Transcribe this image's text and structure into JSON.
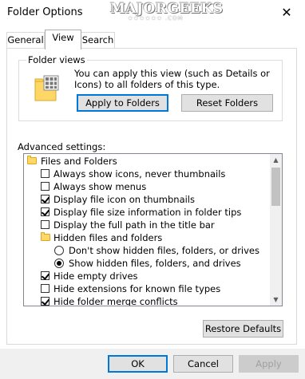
{
  "window": {
    "title": "Folder Options",
    "close_glyph": "✕"
  },
  "watermark": {
    "text": "MAJORGEEKS",
    "sub": "★★★★★★ .COM"
  },
  "tabs": [
    {
      "label": "General",
      "active": false
    },
    {
      "label": "View",
      "active": true
    },
    {
      "label": "Search",
      "active": false
    }
  ],
  "folder_views": {
    "label": "Folder views",
    "description": "You can apply this view (such as Details or Icons) to all folders of this type.",
    "apply_label": "Apply to Folders",
    "reset_label": "Reset Folders"
  },
  "advanced": {
    "label": "Advanced settings:",
    "items": [
      {
        "type": "folder",
        "label": "Files and Folders"
      },
      {
        "type": "checkbox",
        "label": "Always show icons, never thumbnails",
        "checked": false
      },
      {
        "type": "checkbox",
        "label": "Always show menus",
        "checked": false
      },
      {
        "type": "checkbox",
        "label": "Display file icon on thumbnails",
        "checked": true
      },
      {
        "type": "checkbox",
        "label": "Display file size information in folder tips",
        "checked": true
      },
      {
        "type": "checkbox",
        "label": "Display the full path in the title bar",
        "checked": false
      },
      {
        "type": "folder",
        "label": "Hidden files and folders",
        "indent": 1
      },
      {
        "type": "radio",
        "label": "Don't show hidden files, folders, or drives",
        "checked": false,
        "indent": 2
      },
      {
        "type": "radio",
        "label": "Show hidden files, folders, and drives",
        "checked": true,
        "indent": 2
      },
      {
        "type": "checkbox",
        "label": "Hide empty drives",
        "checked": true
      },
      {
        "type": "checkbox",
        "label": "Hide extensions for known file types",
        "checked": false
      },
      {
        "type": "checkbox",
        "label": "Hide folder merge conflicts",
        "checked": true
      }
    ]
  },
  "restore_label": "Restore Defaults",
  "footer": {
    "ok": "OK",
    "cancel": "Cancel",
    "apply": "Apply"
  },
  "colors": {
    "accent": "#0078d7",
    "folder": "#ffd766",
    "footer_bg": "#f0f0f0"
  }
}
